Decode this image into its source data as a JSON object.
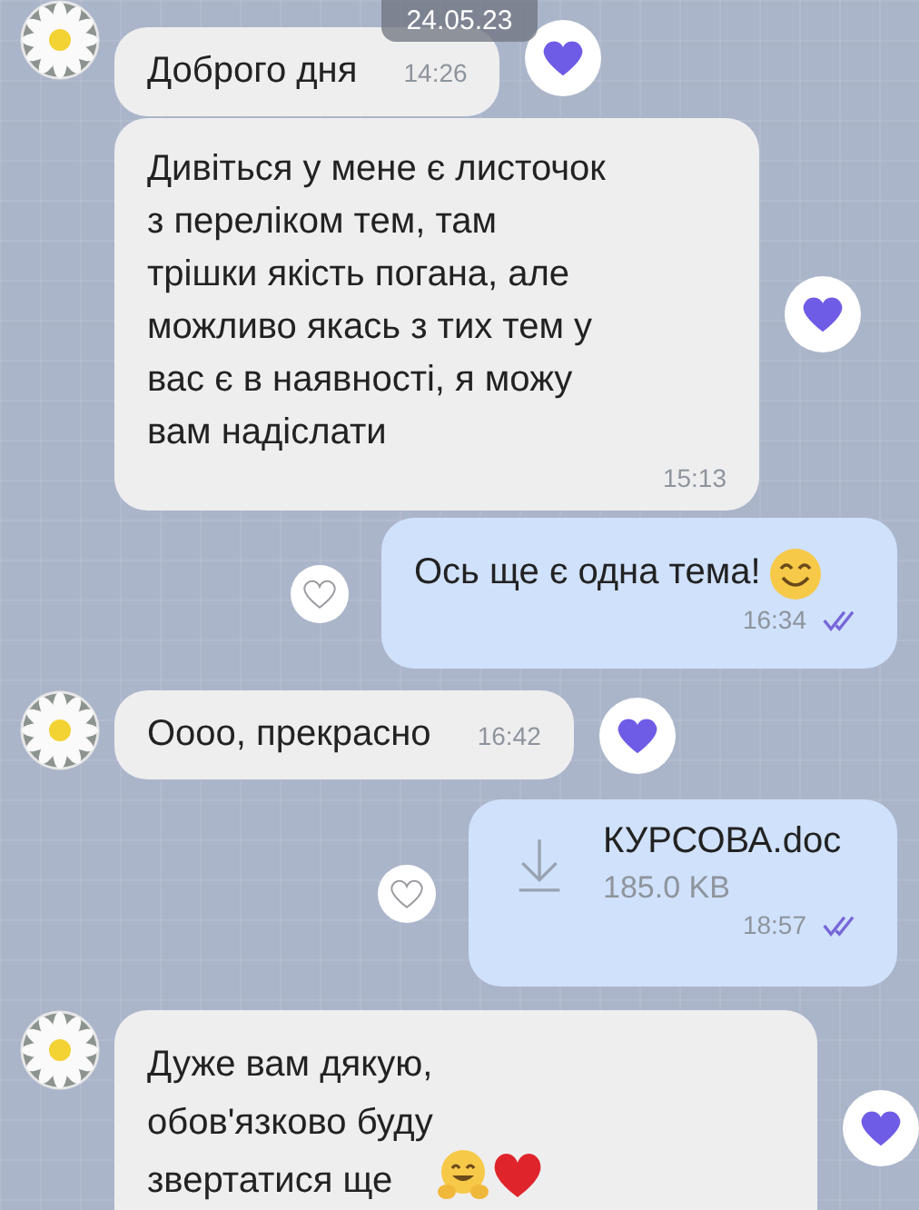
{
  "date_badge": "24.05.23",
  "messages": [
    {
      "outgoing": false,
      "kind": "text",
      "avatar": true,
      "text": "Доброго дня",
      "time": "14:26",
      "liked": true
    },
    {
      "outgoing": false,
      "kind": "text",
      "avatar": false,
      "text": "Дивіться у мене є листочок\nз переліком тем, там\nтрішки якість погана, але\nможливо якась з тих тем у\nвас є в наявності, я можу\nвам надіслати",
      "time": "15:13",
      "liked": true
    },
    {
      "outgoing": true,
      "kind": "text",
      "text": "Ось ще є одна тема!",
      "emoji": [
        {
          "kind": "smiling-face"
        }
      ],
      "time": "16:34",
      "read": true,
      "liked": false
    },
    {
      "outgoing": false,
      "kind": "text",
      "avatar": true,
      "text": "Оооо, прекрасно",
      "time": "16:42",
      "liked": true
    },
    {
      "outgoing": true,
      "kind": "file",
      "file_name": "КУРСОВА.doc",
      "file_size": "185.0 KB",
      "time": "18:57",
      "read": true,
      "liked": false
    },
    {
      "outgoing": false,
      "kind": "text",
      "avatar": true,
      "text": "Дуже вам дякую,\nобов'язково буду\nзвертатися ще",
      "emoji": [
        {
          "kind": "hugging-face"
        },
        {
          "kind": "red-heart"
        }
      ],
      "liked": true
    }
  ]
}
